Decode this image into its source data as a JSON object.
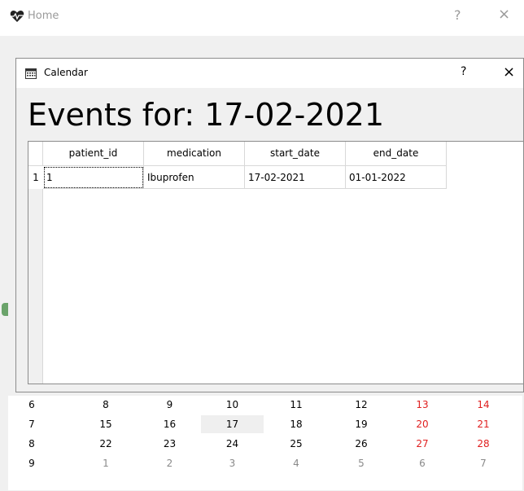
{
  "main_window": {
    "title": "Home",
    "icon": "heart-pulse-icon",
    "help_label": "?",
    "close_label": "×"
  },
  "calendar": {
    "rows": [
      {
        "week": "6",
        "days": [
          "8",
          "9",
          "10",
          "11",
          "12",
          "13",
          "14"
        ]
      },
      {
        "week": "7",
        "days": [
          "15",
          "16",
          "17",
          "18",
          "19",
          "20",
          "21"
        ]
      },
      {
        "week": "8",
        "days": [
          "22",
          "23",
          "24",
          "25",
          "26",
          "27",
          "28"
        ]
      },
      {
        "week": "9",
        "days": [
          "1",
          "2",
          "3",
          "4",
          "5",
          "6",
          "7"
        ]
      }
    ],
    "selected": "17",
    "weekend_color": "#e02020"
  },
  "dialog": {
    "title": "Calendar",
    "icon": "calendar-icon",
    "help_label": "?",
    "close_label": "×",
    "heading": "Events for: 17-02-2021",
    "table": {
      "columns": [
        "patient_id",
        "medication",
        "start_date",
        "end_date"
      ],
      "rows": [
        {
          "index": "1",
          "cells": [
            "1",
            "Ibuprofen",
            "17-02-2021",
            "01-01-2022"
          ]
        }
      ]
    }
  }
}
